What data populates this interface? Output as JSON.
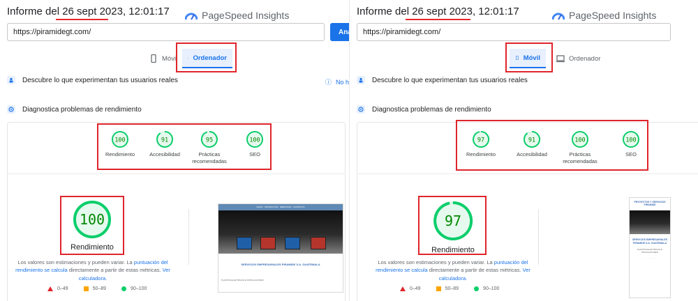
{
  "left": {
    "report_date": "Informe del 26 sept 2023, 12:01:17",
    "brand": "PageSpeed Insights",
    "url": "https://piramidegt.com/",
    "analyze_label": "Anali",
    "tabs": [
      {
        "label": "Móvil",
        "active": false
      },
      {
        "label": "Ordenador",
        "active": true
      }
    ],
    "real_users_text": "Descubre lo que experimentan tus usuarios reales",
    "real_users_link": "No ha",
    "diagnose_text": "Diagnostica problemas de rendimiento",
    "scores": [
      {
        "value": "100",
        "label": "Rendimiento"
      },
      {
        "value": "91",
        "label": "Accesibilidad"
      },
      {
        "value": "95",
        "label": "Prácticas recomendadas"
      },
      {
        "value": "100",
        "label": "SEO"
      }
    ],
    "big_score": "100",
    "big_label": "Rendimiento",
    "desc_part1": "Los valores son estimaciones y pueden variar. La ",
    "desc_link1": "puntuación del rendimiento se calcula",
    "desc_part2": " directamente a partir de estas métricas. ",
    "desc_link2": "Ver calculadora.",
    "legend": [
      "0–49",
      "50–89",
      "90–100"
    ],
    "shot_nav_text": "INICIO · PRODUCTOS · SERVICIOS · CONTACTO",
    "shot_title": "SERVICIOS EMPRESARIALES PIRAMIDE S.A. GUATEMALA",
    "shot_section": "PLANTAS ELECTRICAS E INSTALACIONES"
  },
  "right": {
    "report_date": "Informe del 26 sept 2023, 12:01:17",
    "brand": "PageSpeed Insights",
    "url": "https://piramidegt.com/",
    "tabs": [
      {
        "label": "Móvil",
        "active": true
      },
      {
        "label": "Ordenador",
        "active": false
      }
    ],
    "real_users_text": "Descubre lo que experimentan tus usuarios reales",
    "diagnose_text": "Diagnostica problemas de rendimiento",
    "scores": [
      {
        "value": "97",
        "label": "Rendimiento"
      },
      {
        "value": "91",
        "label": "Accesibilidad"
      },
      {
        "value": "100",
        "label": "Prácticas recomendadas"
      },
      {
        "value": "100",
        "label": "SEO"
      }
    ],
    "big_score": "97",
    "big_label": "Rendimiento",
    "desc_part1": "Los valores son estimaciones y pueden variar. La ",
    "desc_link1": "puntuación del rendimiento se calcula",
    "desc_part2": " directamente a partir de estas métricas. ",
    "desc_link2": "Ver calculadora.",
    "legend": [
      "0–49",
      "50–89",
      "90–100"
    ],
    "shot_header": "PROYECTOS Y SERVICIOS PIRAMIDE",
    "shot_title": "SERVICIOS EMPRESARIALES PIRAMIDE S.A. GUATEMALA",
    "shot_section": "PLANTAS ELECTRICAS E INSTALACIONES"
  },
  "colors": {
    "good": "#0cce6b",
    "good_text": "#008800",
    "accent": "#1a73e8",
    "highlight": "#e0242b"
  }
}
